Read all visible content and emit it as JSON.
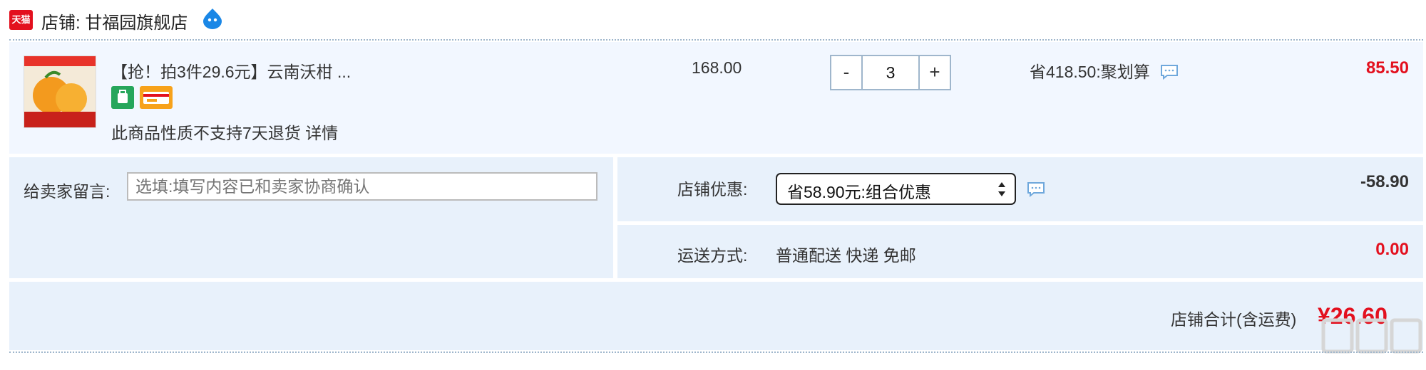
{
  "shop": {
    "logo_text": "天猫",
    "name_label": "店铺: 甘福园旗舰店"
  },
  "item": {
    "title": "【抢！拍3件29.6元】云南沃柑 ...",
    "notice": "此商品性质不支持7天退货 详情",
    "unit_price": "168.00",
    "qty": {
      "minus": "-",
      "value": "3",
      "plus": "+"
    },
    "savings": "省418.50:聚划算",
    "subtotal": "85.50"
  },
  "message": {
    "label": "给卖家留言:",
    "placeholder": "选填:填写内容已和卖家协商确认"
  },
  "promo": {
    "label": "店铺优惠:",
    "selected": "省58.90元:组合优惠",
    "amount": "-58.90"
  },
  "shipping": {
    "label": "运送方式:",
    "value": "普通配送 快递 免邮",
    "amount": "0.00"
  },
  "total": {
    "label": "店铺合计(含运费)",
    "amount": "¥26.60"
  },
  "colors": {
    "accent_red": "#e3101e",
    "row_bg": "#f2f7ff",
    "section_bg": "#e8f1fb",
    "border_blue": "#9fb6cc"
  },
  "icons": [
    "tmall-logo",
    "wangwang-icon",
    "chat-bubble-icon",
    "select-arrows-icon"
  ]
}
